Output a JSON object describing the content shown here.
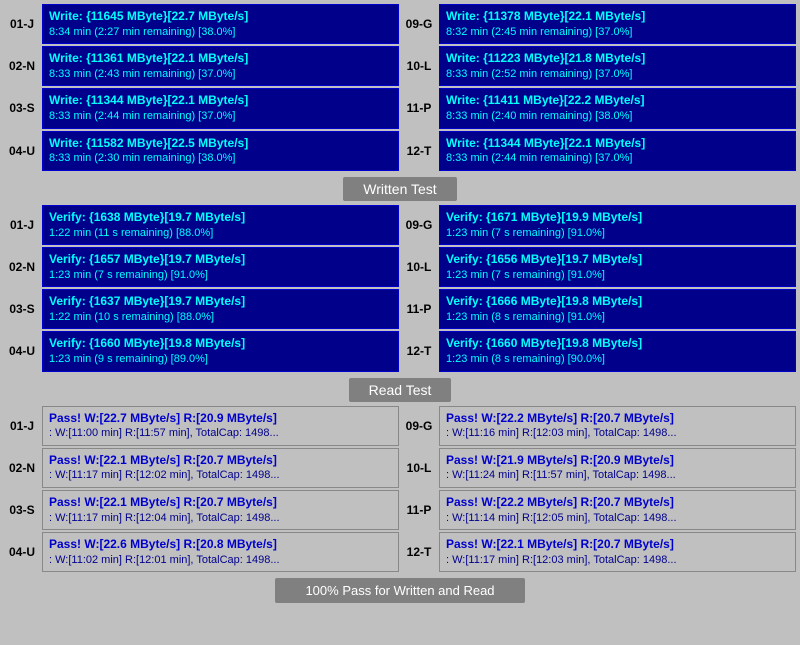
{
  "sections": {
    "write": {
      "rows": [
        {
          "left_id": "01-J",
          "left_line1": "Write: {11645 MByte}[22.7 MByte/s]",
          "left_line2": "8:34 min (2:27 min remaining)  [38.0%]",
          "right_id": "09-G",
          "right_line1": "Write: {11378 MByte}[22.1 MByte/s]",
          "right_line2": "8:32 min (2:45 min remaining)  [37.0%]"
        },
        {
          "left_id": "02-N",
          "left_line1": "Write: {11361 MByte}[22.1 MByte/s]",
          "left_line2": "8:33 min (2:43 min remaining)  [37.0%]",
          "right_id": "10-L",
          "right_line1": "Write: {11223 MByte}[21.8 MByte/s]",
          "right_line2": "8:33 min (2:52 min remaining)  [37.0%]"
        },
        {
          "left_id": "03-S",
          "left_line1": "Write: {11344 MByte}[22.1 MByte/s]",
          "left_line2": "8:33 min (2:44 min remaining)  [37.0%]",
          "right_id": "11-P",
          "right_line1": "Write: {11411 MByte}[22.2 MByte/s]",
          "right_line2": "8:33 min (2:40 min remaining)  [38.0%]"
        },
        {
          "left_id": "04-U",
          "left_line1": "Write: {11582 MByte}[22.5 MByte/s]",
          "left_line2": "8:33 min (2:30 min remaining)  [38.0%]",
          "right_id": "12-T",
          "right_line1": "Write: {11344 MByte}[22.1 MByte/s]",
          "right_line2": "8:33 min (2:44 min remaining)  [37.0%]"
        }
      ]
    },
    "written_test_label": "Written Test",
    "verify": {
      "rows": [
        {
          "left_id": "01-J",
          "left_line1": "Verify: {1638 MByte}[19.7 MByte/s]",
          "left_line2": "1:22 min (11 s remaining)  [88.0%]",
          "right_id": "09-G",
          "right_line1": "Verify: {1671 MByte}[19.9 MByte/s]",
          "right_line2": "1:23 min (7 s remaining)  [91.0%]"
        },
        {
          "left_id": "02-N",
          "left_line1": "Verify: {1657 MByte}[19.7 MByte/s]",
          "left_line2": "1:23 min (7 s remaining)  [91.0%]",
          "right_id": "10-L",
          "right_line1": "Verify: {1656 MByte}[19.7 MByte/s]",
          "right_line2": "1:23 min (7 s remaining)  [91.0%]"
        },
        {
          "left_id": "03-S",
          "left_line1": "Verify: {1637 MByte}[19.7 MByte/s]",
          "left_line2": "1:22 min (10 s remaining)  [88.0%]",
          "right_id": "11-P",
          "right_line1": "Verify: {1666 MByte}[19.8 MByte/s]",
          "right_line2": "1:23 min (8 s remaining)  [91.0%]"
        },
        {
          "left_id": "04-U",
          "left_line1": "Verify: {1660 MByte}[19.8 MByte/s]",
          "left_line2": "1:23 min (9 s remaining)  [89.0%]",
          "right_id": "12-T",
          "right_line1": "Verify: {1660 MByte}[19.8 MByte/s]",
          "right_line2": "1:23 min (8 s remaining)  [90.0%]"
        }
      ]
    },
    "read_test_label": "Read Test",
    "pass": {
      "rows": [
        {
          "left_id": "01-J",
          "left_line1": "Pass! W:[22.7 MByte/s] R:[20.9 MByte/s]",
          "left_line2": ": W:[11:00 min] R:[11:57 min], TotalCap: 1498...",
          "right_id": "09-G",
          "right_line1": "Pass! W:[22.2 MByte/s] R:[20.7 MByte/s]",
          "right_line2": ": W:[11:16 min] R:[12:03 min], TotalCap: 1498..."
        },
        {
          "left_id": "02-N",
          "left_line1": "Pass! W:[22.1 MByte/s] R:[20.7 MByte/s]",
          "left_line2": ": W:[11:17 min] R:[12:02 min], TotalCap: 1498...",
          "right_id": "10-L",
          "right_line1": "Pass! W:[21.9 MByte/s] R:[20.9 MByte/s]",
          "right_line2": ": W:[11:24 min] R:[11:57 min], TotalCap: 1498..."
        },
        {
          "left_id": "03-S",
          "left_line1": "Pass! W:[22.1 MByte/s] R:[20.7 MByte/s]",
          "left_line2": ": W:[11:17 min] R:[12:04 min], TotalCap: 1498...",
          "right_id": "11-P",
          "right_line1": "Pass! W:[22.2 MByte/s] R:[20.7 MByte/s]",
          "right_line2": ": W:[11:14 min] R:[12:05 min], TotalCap: 1498..."
        },
        {
          "left_id": "04-U",
          "left_line1": "Pass! W:[22.6 MByte/s] R:[20.8 MByte/s]",
          "left_line2": ": W:[11:02 min] R:[12:01 min], TotalCap: 1498...",
          "right_id": "12-T",
          "right_line1": "Pass! W:[22.1 MByte/s] R:[20.7 MByte/s]",
          "right_line2": ": W:[11:17 min] R:[12:03 min], TotalCap: 1498..."
        }
      ]
    },
    "bottom_label": "100% Pass for Written and Read"
  }
}
